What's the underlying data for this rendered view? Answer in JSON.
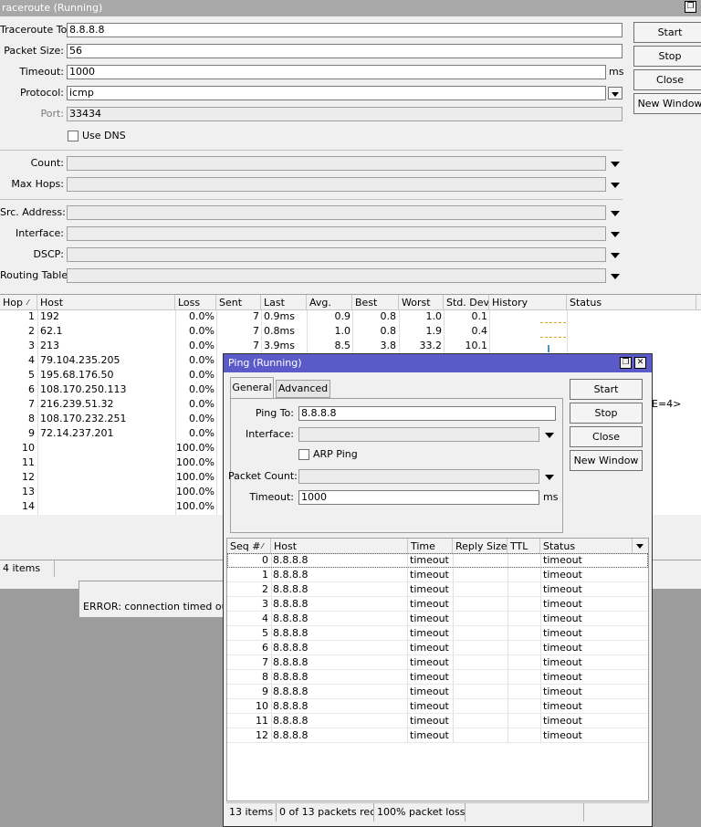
{
  "traceroute": {
    "title": "raceroute (Running)",
    "fields": {
      "to_label": "Traceroute To:",
      "to_value": "8.8.8.8",
      "packet_size_label": "Packet Size:",
      "packet_size_value": "56",
      "timeout_label": "Timeout:",
      "timeout_value": "1000",
      "timeout_unit": "ms",
      "protocol_label": "Protocol:",
      "protocol_value": "icmp",
      "port_label": "Port:",
      "port_value": "33434",
      "use_dns_label": "Use DNS",
      "count_label": "Count:",
      "max_hops_label": "Max Hops:",
      "src_address_label": "Src. Address:",
      "interface_label": "Interface:",
      "dscp_label": "DSCP:",
      "routing_table_label": "Routing Table:"
    },
    "buttons": {
      "start": "Start",
      "stop": "Stop",
      "close": "Close",
      "new_window": "New Window"
    },
    "columns": [
      "Hop",
      "Host",
      "Loss",
      "Sent",
      "Last",
      "Avg.",
      "Best",
      "Worst",
      "Std. Dev.",
      "History",
      "Status"
    ],
    "rows": [
      {
        "hop": "1",
        "host": "192",
        "loss": "0.0%",
        "sent": "7",
        "last": "0.9ms",
        "avg": "0.9",
        "best": "0.8",
        "worst": "1.0",
        "std": "0.1"
      },
      {
        "hop": "2",
        "host": "62.1",
        "loss": "0.0%",
        "sent": "7",
        "last": "0.8ms",
        "avg": "1.0",
        "best": "0.8",
        "worst": "1.9",
        "std": "0.4"
      },
      {
        "hop": "3",
        "host": "213",
        "loss": "0.0%",
        "sent": "7",
        "last": "3.9ms",
        "avg": "8.5",
        "best": "3.8",
        "worst": "33.2",
        "std": "10.1"
      },
      {
        "hop": "4",
        "host": "79.104.235.205",
        "loss": "0.0%"
      },
      {
        "hop": "5",
        "host": "195.68.176.50",
        "loss": "0.0%"
      },
      {
        "hop": "6",
        "host": "108.170.250.113",
        "loss": "0.0%"
      },
      {
        "hop": "7",
        "host": "216.239.51.32",
        "loss": "0.0%"
      },
      {
        "hop": "8",
        "host": "108.170.232.251",
        "loss": "0.0%"
      },
      {
        "hop": "9",
        "host": "72.14.237.201",
        "loss": "0.0%"
      },
      {
        "hop": "10",
        "host": "",
        "loss": "100.0%"
      },
      {
        "hop": "11",
        "host": "",
        "loss": "100.0%"
      },
      {
        "hop": "12",
        "host": "",
        "loss": "100.0%"
      },
      {
        "hop": "13",
        "host": "",
        "loss": "100.0%"
      },
      {
        "hop": "14",
        "host": "",
        "loss": "100.0%"
      }
    ],
    "status_peek": "E=4>",
    "items_count": "4 items",
    "error": "ERROR: connection timed out"
  },
  "ping": {
    "title": "Ping (Running)",
    "tabs": [
      "General",
      "Advanced"
    ],
    "fields": {
      "ping_to_label": "Ping To:",
      "ping_to_value": "8.8.8.8",
      "interface_label": "Interface:",
      "arp_ping_label": "ARP Ping",
      "packet_count_label": "Packet Count:",
      "timeout_label": "Timeout:",
      "timeout_value": "1000",
      "timeout_unit": "ms"
    },
    "buttons": {
      "start": "Start",
      "stop": "Stop",
      "close": "Close",
      "new_window": "New Window"
    },
    "columns": [
      "Seq #",
      "Host",
      "Time",
      "Reply Size",
      "TTL",
      "Status"
    ],
    "rows": [
      {
        "seq": "0",
        "host": "8.8.8.8",
        "time": "timeout",
        "status": "timeout"
      },
      {
        "seq": "1",
        "host": "8.8.8.8",
        "time": "timeout",
        "status": "timeout"
      },
      {
        "seq": "2",
        "host": "8.8.8.8",
        "time": "timeout",
        "status": "timeout"
      },
      {
        "seq": "3",
        "host": "8.8.8.8",
        "time": "timeout",
        "status": "timeout"
      },
      {
        "seq": "4",
        "host": "8.8.8.8",
        "time": "timeout",
        "status": "timeout"
      },
      {
        "seq": "5",
        "host": "8.8.8.8",
        "time": "timeout",
        "status": "timeout"
      },
      {
        "seq": "6",
        "host": "8.8.8.8",
        "time": "timeout",
        "status": "timeout"
      },
      {
        "seq": "7",
        "host": "8.8.8.8",
        "time": "timeout",
        "status": "timeout"
      },
      {
        "seq": "8",
        "host": "8.8.8.8",
        "time": "timeout",
        "status": "timeout"
      },
      {
        "seq": "9",
        "host": "8.8.8.8",
        "time": "timeout",
        "status": "timeout"
      },
      {
        "seq": "10",
        "host": "8.8.8.8",
        "time": "timeout",
        "status": "timeout"
      },
      {
        "seq": "11",
        "host": "8.8.8.8",
        "time": "timeout",
        "status": "timeout"
      },
      {
        "seq": "12",
        "host": "8.8.8.8",
        "time": "timeout",
        "status": "timeout"
      }
    ],
    "status_bar": [
      "13 items",
      "0 of 13 packets rec...",
      "100% packet loss"
    ]
  },
  "colors": {
    "active_title": "#5a5ac8",
    "inactive_title": "#a8a8a8",
    "desktop": "#9c9c9c",
    "history_line": "#e0a020",
    "history_bar": "#4a90c0"
  },
  "icons": [
    "maximize-icon",
    "close-icon",
    "dropdown-arrow-icon",
    "sort-icon"
  ]
}
